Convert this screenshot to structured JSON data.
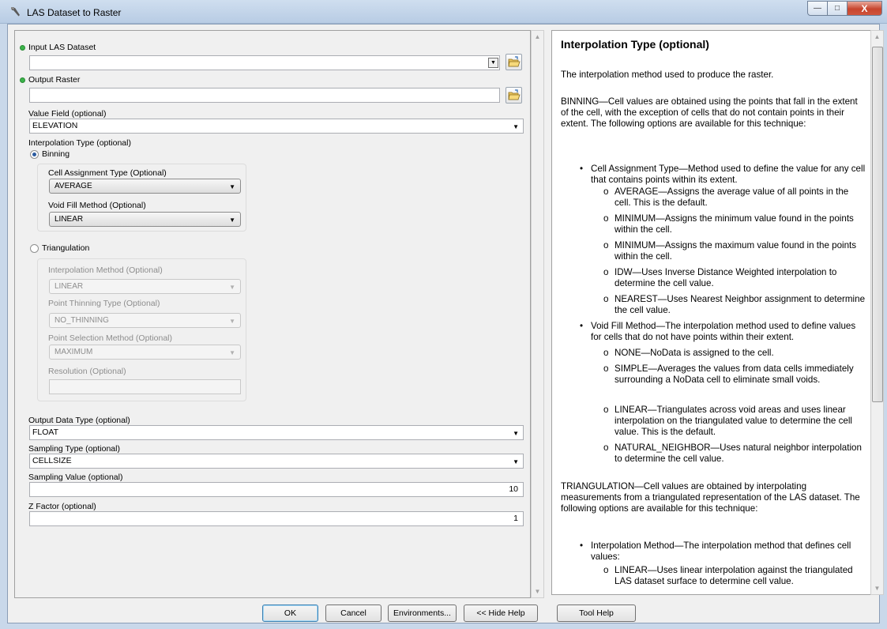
{
  "window": {
    "title": "LAS Dataset to Raster",
    "minimize": "—",
    "maximize": "□",
    "close": "X"
  },
  "form": {
    "input_las_label": "Input LAS Dataset",
    "input_las_value": "",
    "output_raster_label": "Output Raster",
    "output_raster_value": "",
    "value_field_label": "Value Field (optional)",
    "value_field_value": "ELEVATION",
    "interp_type_label": "Interpolation Type (optional)",
    "binning_label": "Binning",
    "cell_assign_label": "Cell Assignment Type (Optional)",
    "cell_assign_value": "AVERAGE",
    "void_fill_label": "Void Fill Method (Optional)",
    "void_fill_value": "LINEAR",
    "triangulation_label": "Triangulation",
    "interp_method_label": "Interpolation Method (Optional)",
    "interp_method_value": "LINEAR",
    "thinning_label": "Point Thinning Type (Optional)",
    "thinning_value": "NO_THINNING",
    "selection_label": "Point Selection Method (Optional)",
    "selection_value": "MAXIMUM",
    "resolution_label": "Resolution (Optional)",
    "resolution_value": "",
    "output_type_label": "Output Data Type (optional)",
    "output_type_value": "FLOAT",
    "sampling_type_label": "Sampling Type (optional)",
    "sampling_type_value": "CELLSIZE",
    "sampling_value_label": "Sampling Value (optional)",
    "sampling_value_value": "10",
    "z_factor_label": "Z Factor (optional)",
    "z_factor_value": "1"
  },
  "buttons": {
    "ok": "OK",
    "cancel": "Cancel",
    "environments": "Environments...",
    "hide_help": "<< Hide Help",
    "tool_help": "Tool Help"
  },
  "help": {
    "title": "Interpolation Type (optional)",
    "p1": "The interpolation method used to produce the raster.",
    "p2": "BINNING—Cell values are obtained using the points that fall in the extent of the cell, with the exception of cells that do not contain points in their extent. The following options are available for this technique:",
    "b1": "Cell Assignment Type—Method used to define the value for any cell that contains points within its extent.",
    "b1a": "AVERAGE—Assigns the average value of all points in the cell. This is the default.",
    "b1b": "MINIMUM—Assigns the minimum value found in the points within the cell.",
    "b1c": "MINIMUM—Assigns the maximum value found in the points within the cell.",
    "b1d": "IDW—Uses Inverse Distance Weighted interpolation to determine the cell value.",
    "b1e": "NEAREST—Uses Nearest Neighbor assignment to determine the cell value.",
    "b2": "Void Fill Method—The interpolation method used to define values for cells that do not have points within their extent.",
    "b2a": "NONE—NoData is assigned to the cell.",
    "b2b": "SIMPLE—Averages the values from data cells immediately surrounding a NoData cell to eliminate small voids.",
    "b2c": "LINEAR—Triangulates across void areas and uses linear interpolation on the triangulated value to determine the cell value. This is the default.",
    "b2d": "NATURAL_NEIGHBOR—Uses natural neighbor interpolation to determine the cell value.",
    "p3": "TRIANGULATION—Cell values are obtained by interpolating measurements from a triangulated representation of the LAS dataset. The following options are available for this technique:",
    "b3": "Interpolation Method—The interpolation method that defines cell values:",
    "b3a": "LINEAR—Uses linear interpolation against the triangulated LAS dataset surface to determine cell value."
  }
}
